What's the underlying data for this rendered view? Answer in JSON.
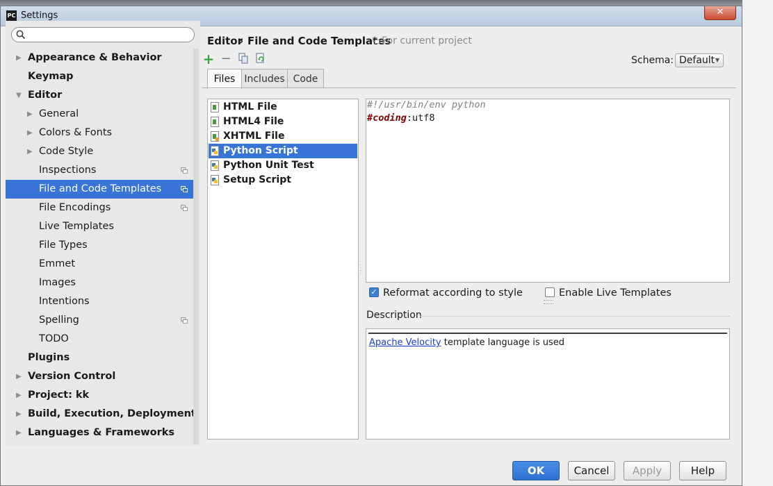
{
  "window": {
    "title": "Settings",
    "app_icon": "PC",
    "close_glyph": "✕"
  },
  "search": {
    "placeholder": "",
    "value": ""
  },
  "tree": [
    {
      "label": "Appearance & Behavior",
      "bold": true,
      "arrow": "▶",
      "indent": 0
    },
    {
      "label": "Keymap",
      "bold": true,
      "arrow": "",
      "indent": 0
    },
    {
      "label": "Editor",
      "bold": true,
      "arrow": "▼",
      "indent": 0
    },
    {
      "label": "General",
      "bold": false,
      "arrow": "▶",
      "indent": 1
    },
    {
      "label": "Colors & Fonts",
      "bold": false,
      "arrow": "▶",
      "indent": 1
    },
    {
      "label": "Code Style",
      "bold": false,
      "arrow": "▶",
      "indent": 1
    },
    {
      "label": "Inspections",
      "bold": false,
      "arrow": "",
      "indent": 1,
      "project_icon": true
    },
    {
      "label": "File and Code Templates",
      "bold": false,
      "arrow": "",
      "indent": 1,
      "project_icon": true,
      "selected": true
    },
    {
      "label": "File Encodings",
      "bold": false,
      "arrow": "",
      "indent": 1,
      "project_icon": true
    },
    {
      "label": "Live Templates",
      "bold": false,
      "arrow": "",
      "indent": 1
    },
    {
      "label": "File Types",
      "bold": false,
      "arrow": "",
      "indent": 1
    },
    {
      "label": "Emmet",
      "bold": false,
      "arrow": "",
      "indent": 1
    },
    {
      "label": "Images",
      "bold": false,
      "arrow": "",
      "indent": 1
    },
    {
      "label": "Intentions",
      "bold": false,
      "arrow": "",
      "indent": 1
    },
    {
      "label": "Spelling",
      "bold": false,
      "arrow": "",
      "indent": 1,
      "project_icon": true
    },
    {
      "label": "TODO",
      "bold": false,
      "arrow": "",
      "indent": 1
    },
    {
      "label": "Plugins",
      "bold": true,
      "arrow": "",
      "indent": 0
    },
    {
      "label": "Version Control",
      "bold": true,
      "arrow": "▶",
      "indent": 0
    },
    {
      "label": "Project: kk",
      "bold": true,
      "arrow": "▶",
      "indent": 0
    },
    {
      "label": "Build, Execution, Deployment",
      "bold": true,
      "arrow": "▶",
      "indent": 0
    },
    {
      "label": "Languages & Frameworks",
      "bold": true,
      "arrow": "▶",
      "indent": 0
    }
  ],
  "breadcrumb": {
    "parent": "Editor",
    "separator": "›",
    "current": "File and Code Templates",
    "scope_note": "For current project"
  },
  "toolbar": {
    "add": "+",
    "remove": "−",
    "copy_icon": "copy-icon",
    "reset_icon": "reset-icon"
  },
  "schema": {
    "label": "Schema:",
    "value": "Default"
  },
  "tabs": [
    "Files",
    "Includes",
    "Code"
  ],
  "files": [
    {
      "name": "HTML File",
      "icon": "html"
    },
    {
      "name": "HTML4 File",
      "icon": "html"
    },
    {
      "name": "XHTML File",
      "icon": "xhtml"
    },
    {
      "name": "Python Script",
      "icon": "python",
      "selected": true
    },
    {
      "name": "Python Unit Test",
      "icon": "python"
    },
    {
      "name": "Setup Script",
      "icon": "python"
    }
  ],
  "editor": {
    "line1": "#!/usr/bin/env python",
    "line2_keyword": "#coding",
    "line2_rest": ":utf8"
  },
  "options": {
    "reformat": "Reformat according to style",
    "reformat_checked": true,
    "live_templates": "Enable Live Templates",
    "live_checked": false
  },
  "description": {
    "title": "Description",
    "link": "Apache Velocity",
    "text": " template language is used"
  },
  "buttons": {
    "ok": "OK",
    "cancel": "Cancel",
    "apply": "Apply",
    "help": "Help"
  },
  "colors": {
    "selection": "#3875d7",
    "primary_button": "#2d6fd0",
    "link": "#1a3ed0",
    "keyword": "#7f0000",
    "add_icon": "#3aa541"
  }
}
